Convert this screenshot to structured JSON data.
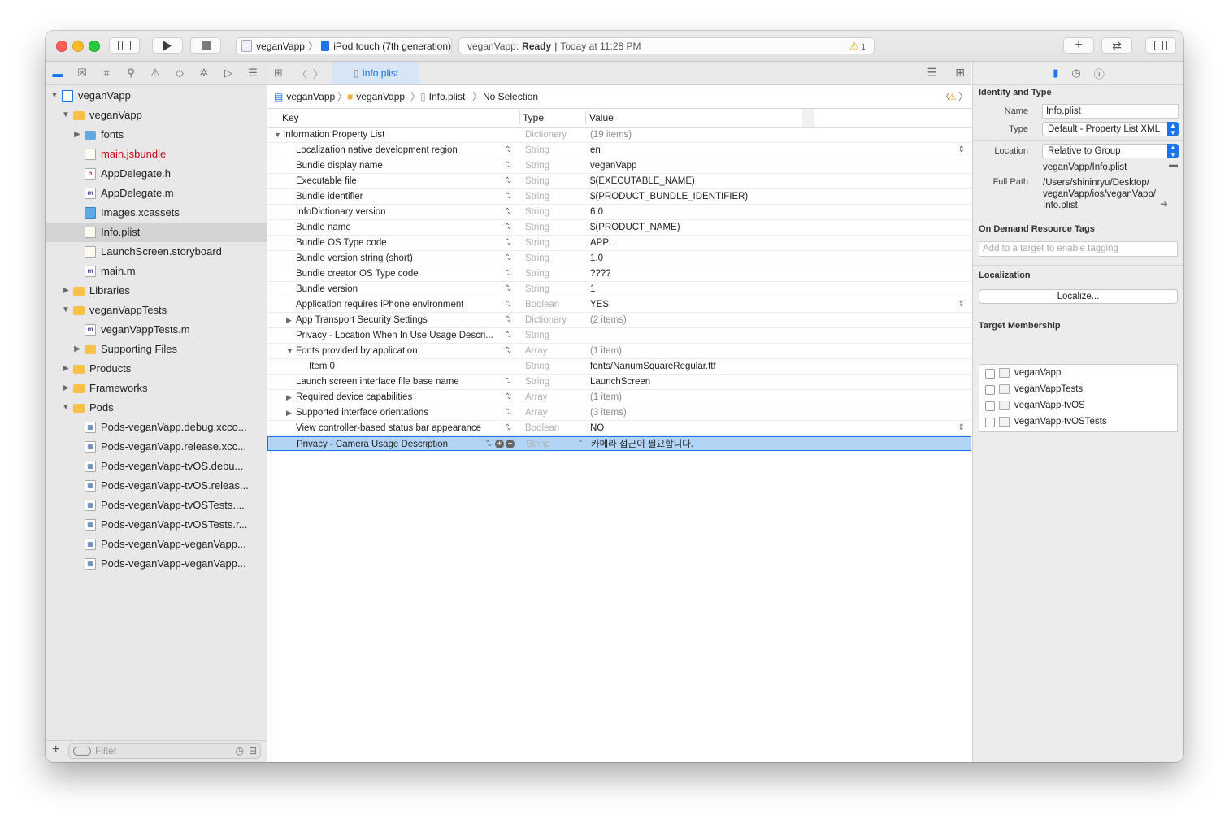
{
  "toolbar": {
    "scheme_project": "veganVapp",
    "scheme_device": "iPod touch (7th generation)",
    "activity_project": "veganVapp:",
    "activity_status": "Ready",
    "activity_time": "Today at 11:28 PM",
    "warning_count": "1",
    "add_symbol": "+",
    "swap_symbol": "⇄"
  },
  "navigator": {
    "filter_placeholder": "Filter",
    "add_symbol": "+",
    "items": [
      {
        "label": "veganVapp",
        "icon": "project-icon"
      },
      {
        "label": "veganVapp",
        "icon": "folder-icon"
      },
      {
        "label": "fonts",
        "icon": "blue-folder-icon"
      },
      {
        "label": "main.jsbundle",
        "icon": "file-icon",
        "color": "#d0021b"
      },
      {
        "label": "AppDelegate.h",
        "icon": "header-file-icon"
      },
      {
        "label": "AppDelegate.m",
        "icon": "source-file-icon"
      },
      {
        "label": "Images.xcassets",
        "icon": "asset-catalog-icon"
      },
      {
        "label": "Info.plist",
        "icon": "plist-file-icon",
        "selected": true
      },
      {
        "label": "LaunchScreen.storyboard",
        "icon": "storyboard-file-icon"
      },
      {
        "label": "main.m",
        "icon": "source-file-icon"
      },
      {
        "label": "Libraries",
        "icon": "folder-icon"
      },
      {
        "label": "veganVappTests",
        "icon": "folder-icon"
      },
      {
        "label": "veganVappTests.m",
        "icon": "source-file-icon"
      },
      {
        "label": "Supporting Files",
        "icon": "folder-icon"
      },
      {
        "label": "Products",
        "icon": "folder-icon"
      },
      {
        "label": "Frameworks",
        "icon": "folder-icon"
      },
      {
        "label": "Pods",
        "icon": "folder-icon"
      },
      {
        "label": "Pods-veganVapp.debug.xcco...",
        "icon": "xcconfig-file-icon"
      },
      {
        "label": "Pods-veganVapp.release.xcc...",
        "icon": "xcconfig-file-icon"
      },
      {
        "label": "Pods-veganVapp-tvOS.debu...",
        "icon": "xcconfig-file-icon"
      },
      {
        "label": "Pods-veganVapp-tvOS.releas...",
        "icon": "xcconfig-file-icon"
      },
      {
        "label": "Pods-veganVapp-tvOSTests....",
        "icon": "xcconfig-file-icon"
      },
      {
        "label": "Pods-veganVapp-tvOSTests.r...",
        "icon": "xcconfig-file-icon"
      },
      {
        "label": "Pods-veganVapp-veganVapp...",
        "icon": "xcconfig-file-icon"
      },
      {
        "label": "Pods-veganVapp-veganVapp...",
        "icon": "xcconfig-file-icon"
      }
    ]
  },
  "editor": {
    "tab_label": "Info.plist",
    "jump": {
      "project": "veganVapp",
      "group": "veganVapp",
      "file": "Info.plist",
      "selection": "No Selection"
    },
    "columns": {
      "key": "Key",
      "type": "Type",
      "value": "Value"
    },
    "rows": [
      {
        "key": "Information Property List",
        "type": "Dictionary",
        "value": "(19 items)"
      },
      {
        "key": "Localization native development region",
        "type": "String",
        "value": "en"
      },
      {
        "key": "Bundle display name",
        "type": "String",
        "value": "veganVapp"
      },
      {
        "key": "Executable file",
        "type": "String",
        "value": "$(EXECUTABLE_NAME)"
      },
      {
        "key": "Bundle identifier",
        "type": "String",
        "value": "$(PRODUCT_BUNDLE_IDENTIFIER)"
      },
      {
        "key": "InfoDictionary version",
        "type": "String",
        "value": "6.0"
      },
      {
        "key": "Bundle name",
        "type": "String",
        "value": "$(PRODUCT_NAME)"
      },
      {
        "key": "Bundle OS Type code",
        "type": "String",
        "value": "APPL"
      },
      {
        "key": "Bundle version string (short)",
        "type": "String",
        "value": "1.0"
      },
      {
        "key": "Bundle creator OS Type code",
        "type": "String",
        "value": "????"
      },
      {
        "key": "Bundle version",
        "type": "String",
        "value": "1"
      },
      {
        "key": "Application requires iPhone environment",
        "type": "Boolean",
        "value": "YES"
      },
      {
        "key": "App Transport Security Settings",
        "type": "Dictionary",
        "value": "(2 items)"
      },
      {
        "key": "Privacy - Location When In Use Usage Descri...",
        "type": "String",
        "value": ""
      },
      {
        "key": "Fonts provided by application",
        "type": "Array",
        "value": "(1 item)"
      },
      {
        "key": "Item 0",
        "type": "String",
        "value": "fonts/NanumSquareRegular.ttf"
      },
      {
        "key": "Launch screen interface file base name",
        "type": "String",
        "value": "LaunchScreen"
      },
      {
        "key": "Required device capabilities",
        "type": "Array",
        "value": "(1 item)"
      },
      {
        "key": "Supported interface orientations",
        "type": "Array",
        "value": "(3 items)"
      },
      {
        "key": "View controller-based status bar appearance",
        "type": "Boolean",
        "value": "NO"
      },
      {
        "key": "Privacy - Camera Usage Description",
        "type": "String",
        "value": "카메라 접근이 필요합니다."
      }
    ]
  },
  "inspector": {
    "identity_header": "Identity and Type",
    "name_label": "Name",
    "name_value": "Info.plist",
    "type_label": "Type",
    "type_value": "Default - Property List XML",
    "location_label": "Location",
    "location_value": "Relative to Group",
    "relative_path": "veganVapp/Info.plist",
    "fullpath_label": "Full Path",
    "fullpath_line1": "/Users/shininryu/Desktop/",
    "fullpath_line2": "veganVapp/ios/veganVapp/",
    "fullpath_line3": "Info.plist",
    "odr_header": "On Demand Resource Tags",
    "odr_placeholder": "Add to a target to enable tagging",
    "localization_header": "Localization",
    "localize_button": "Localize...",
    "membership_header": "Target Membership",
    "targets": [
      "veganVapp",
      "veganVappTests",
      "veganVapp-tvOS",
      "veganVapp-tvOSTests"
    ]
  }
}
